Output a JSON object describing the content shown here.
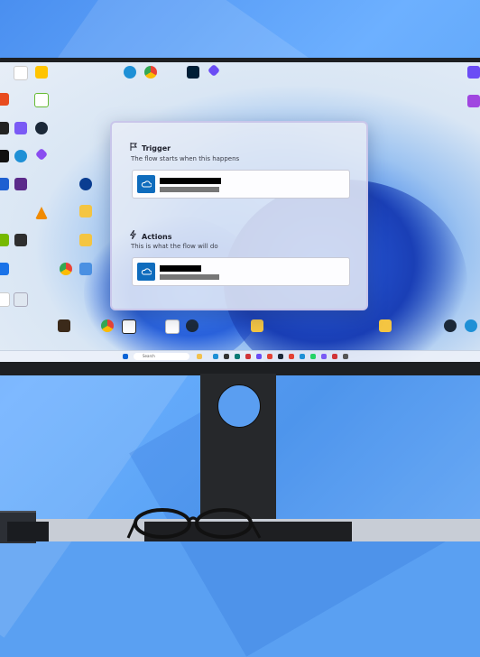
{
  "flow": {
    "trigger": {
      "title": "Trigger",
      "subtitle": "The flow starts when this happens",
      "icon": "flag-icon",
      "step": {
        "name": "",
        "detail": "",
        "icon": "cloud-icon"
      }
    },
    "actions": {
      "title": "Actions",
      "subtitle": "This is what the flow will do",
      "icon": "lightning-icon",
      "step": {
        "name": "",
        "detail": "",
        "icon": "cloud-icon"
      }
    }
  },
  "taskbar": {
    "search_placeholder": "Search"
  },
  "colors": {
    "accent": "#0f6cbd",
    "card_border": "#c9c6ea",
    "background": "#5aa0f2"
  },
  "desktop_icons": [
    {
      "label": "Microsoft Edge",
      "icon": "edge-icon",
      "color": "#1e90d6"
    },
    {
      "label": "Google Chrome",
      "icon": "chrome-icon",
      "color": "#e34234"
    },
    {
      "label": "Steam",
      "icon": "steam-icon",
      "color": "#1b2838"
    },
    {
      "label": "VLC media player",
      "icon": "vlc-icon",
      "color": "#f08a00"
    },
    {
      "label": "Recycle Bin",
      "icon": "recycle-bin-icon",
      "color": "#dfe7f0"
    }
  ]
}
